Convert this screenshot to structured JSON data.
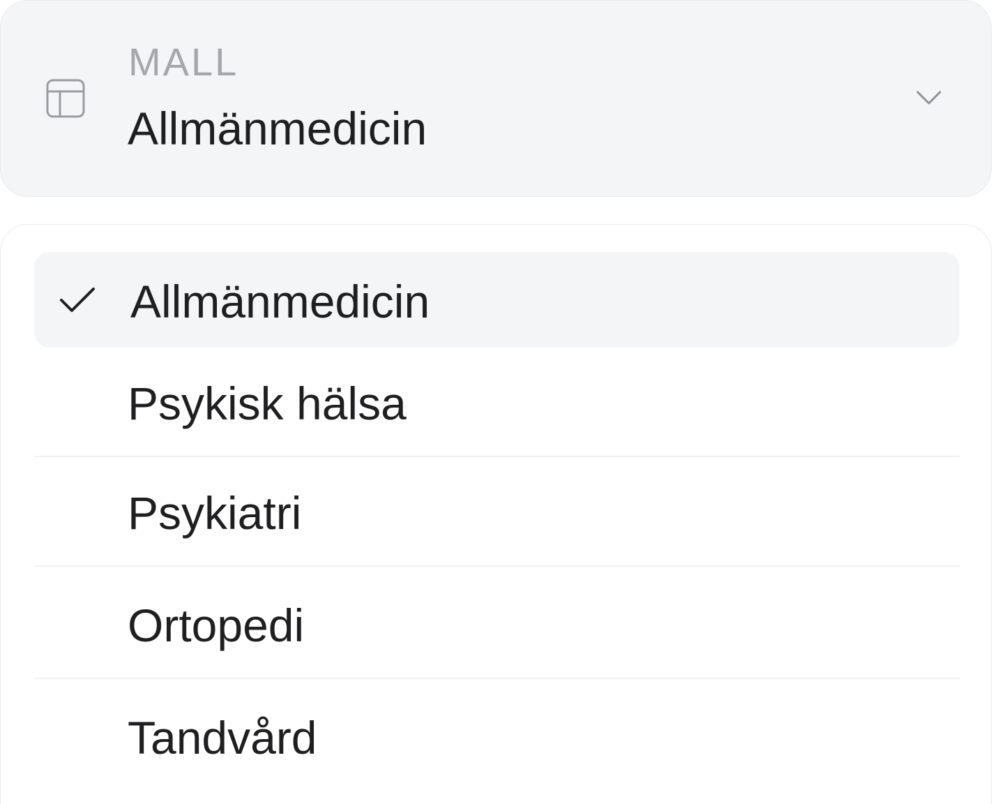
{
  "select": {
    "label": "MALL",
    "value": "Allmänmedicin",
    "icon": "template-icon",
    "toggle_icon": "chevron-down-icon"
  },
  "menu": {
    "options": [
      {
        "label": "Allmänmedicin",
        "selected": true
      },
      {
        "label": "Psykisk hälsa",
        "selected": false
      },
      {
        "label": "Psykiatri",
        "selected": false
      },
      {
        "label": "Ortopedi",
        "selected": false
      },
      {
        "label": "Tandvård",
        "selected": false
      }
    ]
  },
  "colors": {
    "trigger_background": "#f4f5f7",
    "selected_background": "#f4f5f7",
    "text": "#1f1f21",
    "muted_text": "#a6a7aa"
  }
}
